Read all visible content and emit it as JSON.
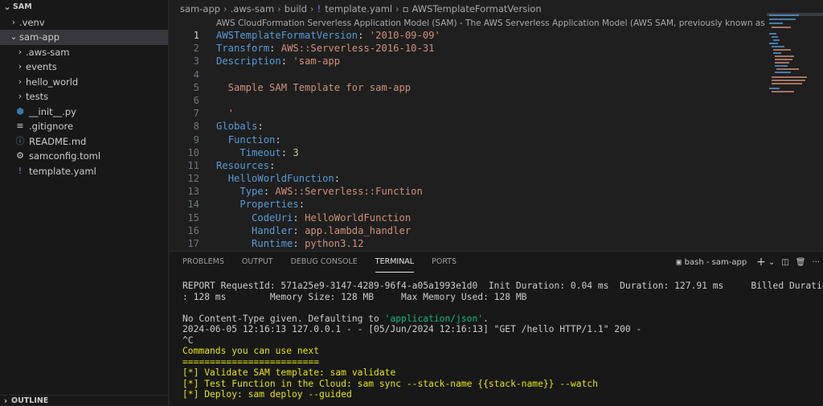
{
  "explorer": {
    "root": "SAM",
    "items": [
      {
        "label": ".venv",
        "chev": "›",
        "indent": 0
      },
      {
        "label": "sam-app",
        "chev": "⌄",
        "indent": 0,
        "selected": true
      },
      {
        "label": ".aws-sam",
        "chev": "›",
        "indent": 1
      },
      {
        "label": "events",
        "chev": "›",
        "indent": 1
      },
      {
        "label": "hello_world",
        "chev": "›",
        "indent": 1
      },
      {
        "label": "tests",
        "chev": "›",
        "indent": 1
      },
      {
        "label": "__init__.py",
        "icon": "python",
        "indent": 1
      },
      {
        "label": ".gitignore",
        "icon": "lines",
        "indent": 1
      },
      {
        "label": "README.md",
        "icon": "info",
        "indent": 1
      },
      {
        "label": "samconfig.toml",
        "icon": "gear",
        "indent": 1
      },
      {
        "label": "template.yaml",
        "icon": "exclaim",
        "indent": 1
      }
    ],
    "outline": "OUTLINE"
  },
  "breadcrumb": [
    "sam-app",
    ".aws-sam",
    "build",
    "template.yaml",
    "AWSTemplateFormatVersion"
  ],
  "hover_text": "AWS CloudFormation Serverless Application Model (SAM) - The AWS Serverless Application Model (AWS SAM, previously known as Project Flourish) ·",
  "code_lines": [
    {
      "n": "1",
      "t": "AWSTemplateFormatVersion: '2010-09-09'"
    },
    {
      "n": "2",
      "t": "Transform: AWS::Serverless-2016-10-31"
    },
    {
      "n": "3",
      "t": "Description: 'sam-app"
    },
    {
      "n": "4",
      "t": ""
    },
    {
      "n": "5",
      "t": "  Sample SAM Template for sam-app"
    },
    {
      "n": "6",
      "t": ""
    },
    {
      "n": "7",
      "t": "  '"
    },
    {
      "n": "8",
      "t": "Globals:"
    },
    {
      "n": "9",
      "t": "  Function:"
    },
    {
      "n": "10",
      "t": "    Timeout: 3"
    },
    {
      "n": "11",
      "t": "Resources:"
    },
    {
      "n": "12",
      "t": "  HelloWorldFunction:"
    },
    {
      "n": "13",
      "t": "    Type: AWS::Serverless::Function"
    },
    {
      "n": "14",
      "t": "    Properties:"
    },
    {
      "n": "15",
      "t": "      CodeUri: HelloWorldFunction"
    },
    {
      "n": "16",
      "t": "      Handler: app.lambda_handler"
    },
    {
      "n": "17",
      "t": "      Runtime: python3.12"
    }
  ],
  "panel": {
    "tabs": [
      "PROBLEMS",
      "OUTPUT",
      "DEBUG CONSOLE",
      "TERMINAL",
      "PORTS"
    ],
    "active_tab": "TERMINAL",
    "terminal_name": "bash - sam-app",
    "add_label": "+",
    "add_chevron": "⌄",
    "split_icon": "◫",
    "trash_icon": "🗑",
    "more_icon": "···"
  },
  "terminal_lines": [
    "REPORT RequestId: 571a25e9-3147-4289-96f4-a05a1993e1d0  Init Duration: 0.04 ms  Duration: 127.91 ms     Billed Duration",
    ": 128 ms        Memory Size: 128 MB     Max Memory Used: 128 MB",
    "",
    "No Content-Type given. Defaulting to 'application/json'.",
    "2024-06-05 12:16:13 127.0.0.1 - - [05/Jun/2024 12:16:13] \"GET /hello HTTP/1.1\" 200 -",
    "^C",
    "Commands you can use next",
    "=========================",
    "[*] Validate SAM template: sam validate",
    "[*] Test Function in the Cloud: sam sync --stack-name {{stack-name}} --watch",
    "[*] Deploy: sam deploy --guided"
  ],
  "colors": {
    "keyword": "#569cd6",
    "string": "#ce9178",
    "number": "#b5cea8",
    "yellow": "#e5e510",
    "green": "#0dbc79"
  }
}
